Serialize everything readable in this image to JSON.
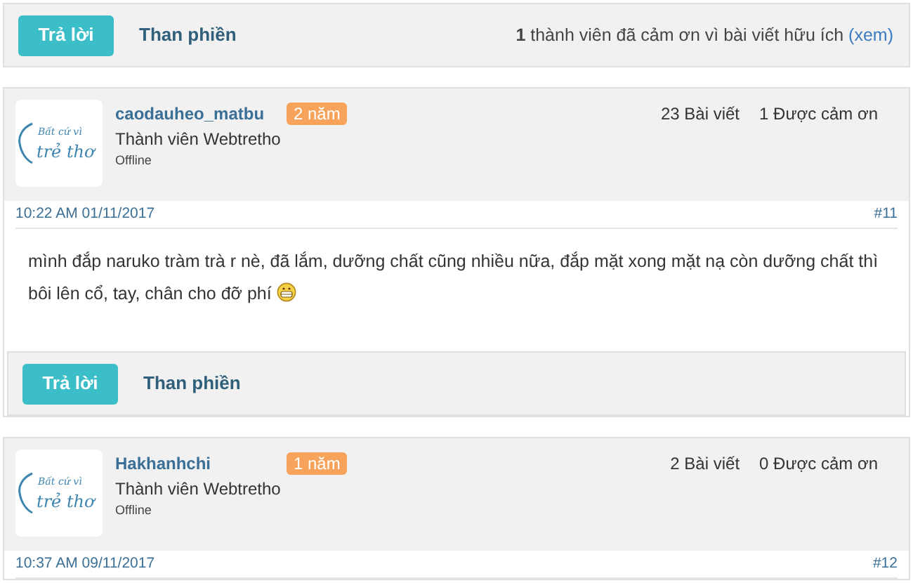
{
  "top_actions": {
    "reply": "Trả lời",
    "complain": "Than phiền",
    "thanks": {
      "count": "1",
      "text": "thành viên đã cảm ơn vì bài viết hữu ích",
      "link": "(xem)"
    }
  },
  "posts": [
    {
      "avatar": {
        "line1": "Bất cứ vì",
        "line2": "trẻ thơ"
      },
      "username": "caodauheo_matbu",
      "badge": "2 năm",
      "role": "Thành viên Webtretho",
      "status": "Offline",
      "post_count": "23 Bài viết",
      "thanks_count": "1 Được cảm ơn",
      "timestamp": "10:22 AM 01/11/2017",
      "number": "#11",
      "body": "mình đắp naruko tràm trà r nè, đã lắm, dưỡng chất cũng nhiều nữa, đắp mặt xong mặt nạ còn dưỡng chất thì bôi lên cổ, tay, chân cho đỡ phí",
      "emoji": true,
      "actions": {
        "reply": "Trả lời",
        "complain": "Than phiền"
      }
    },
    {
      "avatar": {
        "line1": "Bất cứ vì",
        "line2": "trẻ thơ"
      },
      "username": "Hakhanhchi",
      "badge": "1 năm",
      "role": "Thành viên Webtretho",
      "status": "Offline",
      "post_count": "2 Bài viết",
      "thanks_count": "0 Được cảm ơn",
      "timestamp": "10:37 AM 09/11/2017",
      "number": "#12"
    }
  ]
}
